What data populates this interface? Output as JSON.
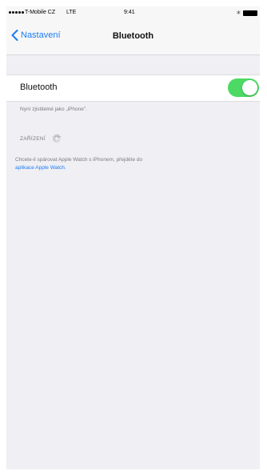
{
  "status_bar": {
    "carrier": "T-Mobile CZ",
    "network": "LTE",
    "time": "9:41",
    "bluetooth_icon": "bluetooth-icon",
    "battery_icon": "battery-icon"
  },
  "nav": {
    "back_label": "Nastavení",
    "back_icon": "chevron-left-icon",
    "title": "Bluetooth"
  },
  "bluetooth_cell": {
    "label": "Bluetooth",
    "enabled": true,
    "toggle_color": "#4cd964"
  },
  "discoverable_note": "Nyní zjistitelné jako „iPhone\".",
  "devices_section": {
    "header": "ZAŘÍZENÍ",
    "loading_icon": "spinner-icon"
  },
  "watch_info": {
    "text": "Chcete-li spárovat Apple Watch s iPhonem, přejděte do",
    "link": "aplikace Apple Watch",
    "suffix": "."
  },
  "colors": {
    "accent": "#1d7cf2",
    "background": "#efeff4"
  }
}
